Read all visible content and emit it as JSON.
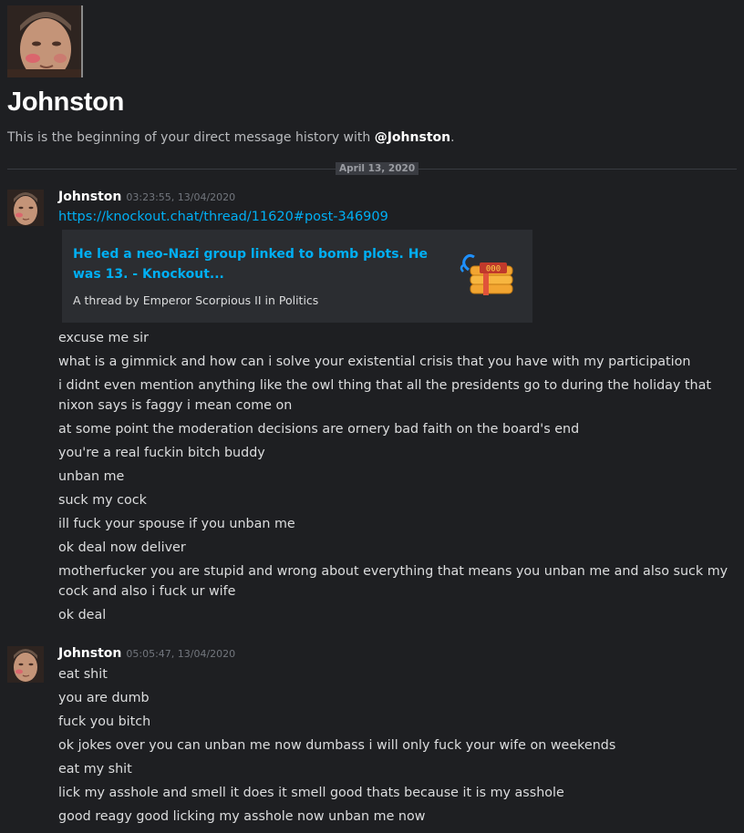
{
  "channel": {
    "title": "Johnston",
    "intro_prefix": "This is the beginning of your direct message history with ",
    "intro_handle": "@Johnston",
    "intro_suffix": "."
  },
  "date_divider": "April 13, 2020",
  "messages": [
    {
      "author": "Johnston",
      "timestamp": "03:23:55, 13/04/2020",
      "link": "https://knockout.chat/thread/11620#post-346909",
      "embed": {
        "title": "He led a neo-Nazi group linked to bomb plots. He was 13. - Knockout...",
        "description": "A thread by Emperor Scorpious II in Politics",
        "thumbnail_icon": "dynamite-icon"
      },
      "lines": [
        "excuse me sir",
        "what is a gimmick and how can i solve your existential crisis that you have with my participation",
        "i didnt even mention anything like the owl thing that all the presidents go to during the holiday that nixon says is faggy i mean come on",
        "at some point the moderation decisions are ornery bad faith on the board's end",
        "you're a real fuckin bitch buddy",
        "unban me",
        "suck my cock",
        "ill fuck your spouse if you unban me",
        "ok deal now deliver",
        "motherfucker you are stupid and wrong about everything that means you unban me and also suck my cock and also i fuck ur wife",
        "ok deal"
      ]
    },
    {
      "author": "Johnston",
      "timestamp": "05:05:47, 13/04/2020",
      "lines": [
        "eat shit",
        "you are dumb",
        "fuck you bitch",
        "ok jokes over you can unban me now dumbass i will only fuck your wife on weekends",
        "eat my shit",
        "lick my asshole and smell it does it smell good thats because it is my asshole",
        "good reagy good licking my asshole now unban me now"
      ]
    }
  ],
  "colors": {
    "background": "#1e1f22",
    "link": "#00aff4",
    "embed_bg": "#2b2d31",
    "text": "#dcddde",
    "muted": "#72767d"
  }
}
